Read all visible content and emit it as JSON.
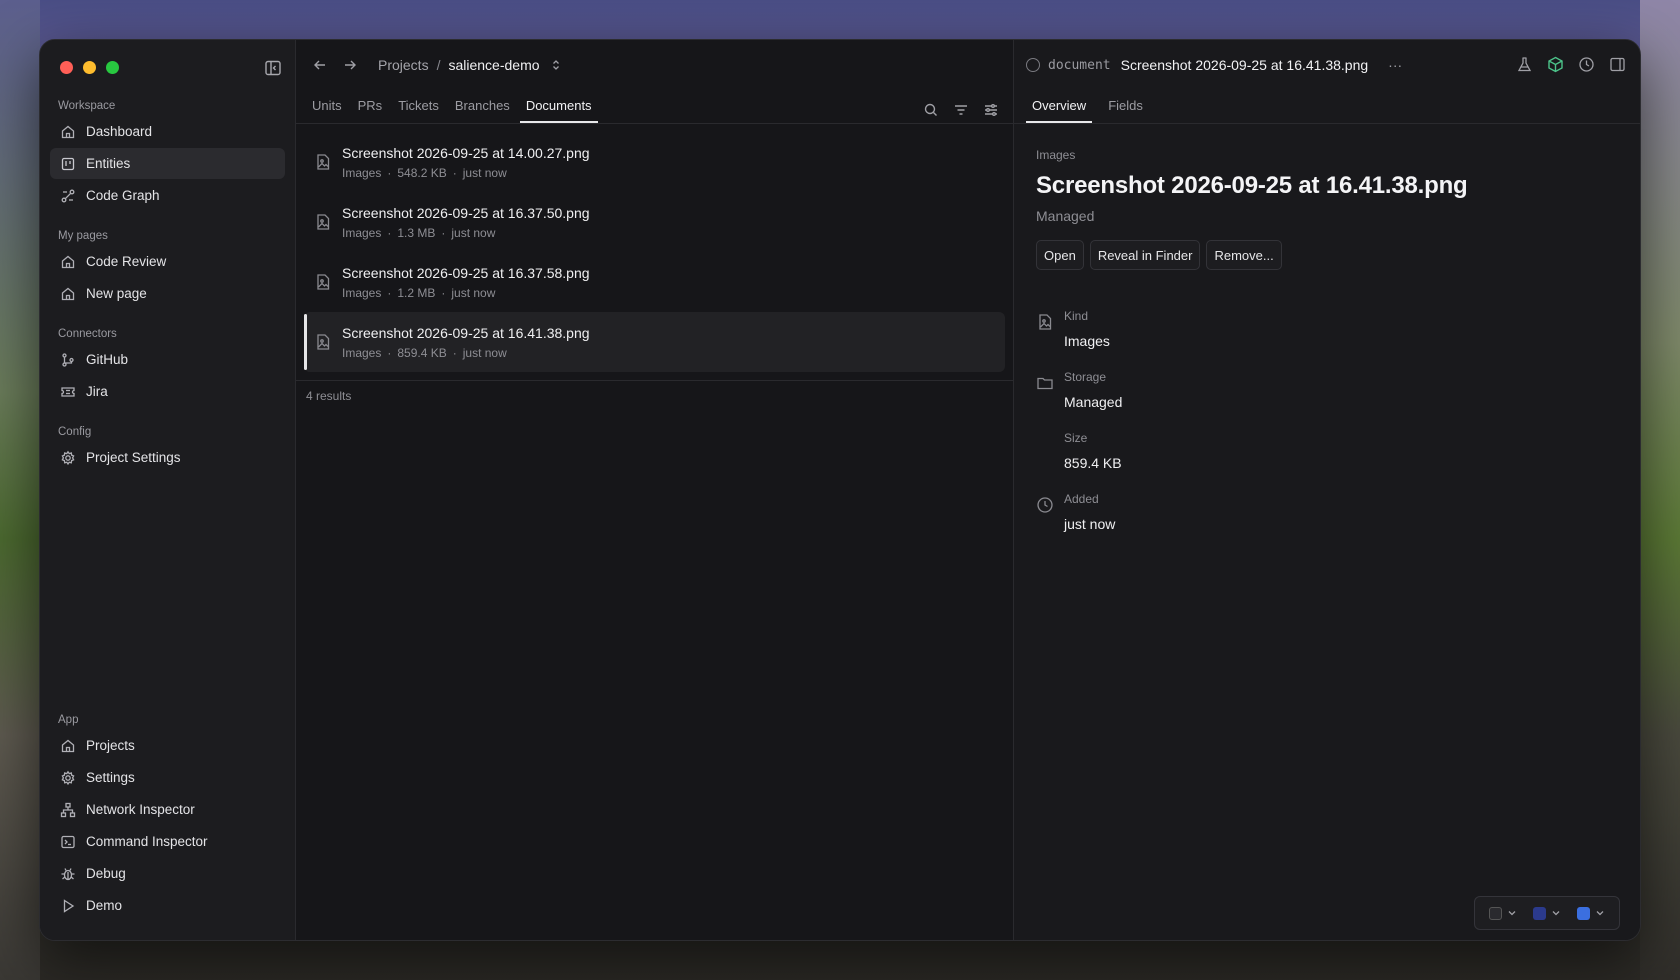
{
  "sidebar": {
    "sections": [
      {
        "label": "Workspace",
        "items": [
          {
            "label": "Dashboard",
            "icon": "home-icon"
          },
          {
            "label": "Entities",
            "icon": "entities-icon",
            "active": true
          },
          {
            "label": "Code Graph",
            "icon": "graph-icon"
          }
        ]
      },
      {
        "label": "My pages",
        "items": [
          {
            "label": "Code Review",
            "icon": "home-icon"
          },
          {
            "label": "New page",
            "icon": "home-icon"
          }
        ]
      },
      {
        "label": "Connectors",
        "items": [
          {
            "label": "GitHub",
            "icon": "git-branch-icon"
          },
          {
            "label": "Jira",
            "icon": "ticket-icon"
          }
        ]
      },
      {
        "label": "Config",
        "items": [
          {
            "label": "Project Settings",
            "icon": "gear-icon"
          }
        ]
      }
    ],
    "app": {
      "label": "App",
      "items": [
        {
          "label": "Projects",
          "icon": "home-icon"
        },
        {
          "label": "Settings",
          "icon": "gear-icon"
        },
        {
          "label": "Network Inspector",
          "icon": "network-icon"
        },
        {
          "label": "Command Inspector",
          "icon": "terminal-icon"
        },
        {
          "label": "Debug",
          "icon": "bug-icon"
        },
        {
          "label": "Demo",
          "icon": "play-icon"
        }
      ]
    }
  },
  "breadcrumb": {
    "root": "Projects",
    "separator": "/",
    "current": "salience-demo"
  },
  "tabs": [
    "Units",
    "PRs",
    "Tickets",
    "Branches",
    "Documents"
  ],
  "active_tab": "Documents",
  "documents": [
    {
      "name": "Screenshot 2026-09-25 at 14.00.27.png",
      "kind": "Images",
      "size": "548.2 KB",
      "added": "just now"
    },
    {
      "name": "Screenshot 2026-09-25 at 16.37.50.png",
      "kind": "Images",
      "size": "1.3 MB",
      "added": "just now"
    },
    {
      "name": "Screenshot 2026-09-25 at 16.37.58.png",
      "kind": "Images",
      "size": "1.2 MB",
      "added": "just now"
    },
    {
      "name": "Screenshot 2026-09-25 at 16.41.38.png",
      "kind": "Images",
      "size": "859.4 KB",
      "added": "just now",
      "selected": true
    }
  ],
  "results_text": "4 results",
  "detail": {
    "type_label": "document",
    "header_name": "Screenshot 2026-09-25 at 16.41.38.png",
    "more": "···",
    "tabs": [
      "Overview",
      "Fields"
    ],
    "category": "Images",
    "title": "Screenshot 2026-09-25 at 16.41.38.png",
    "subtitle": "Managed",
    "buttons": {
      "open": "Open",
      "reveal": "Reveal in Finder",
      "remove": "Remove..."
    },
    "fields": {
      "kind": {
        "label": "Kind",
        "value": "Images"
      },
      "storage": {
        "label": "Storage",
        "value": "Managed"
      },
      "size": {
        "label": "Size",
        "value": "859.4 KB"
      },
      "added": {
        "label": "Added",
        "value": "just now"
      }
    }
  },
  "colors": {
    "accent_red": "#ff5f57",
    "accent_yellow": "#febc2e",
    "accent_green": "#28c840",
    "picker_blue": "#3b6fe0"
  }
}
